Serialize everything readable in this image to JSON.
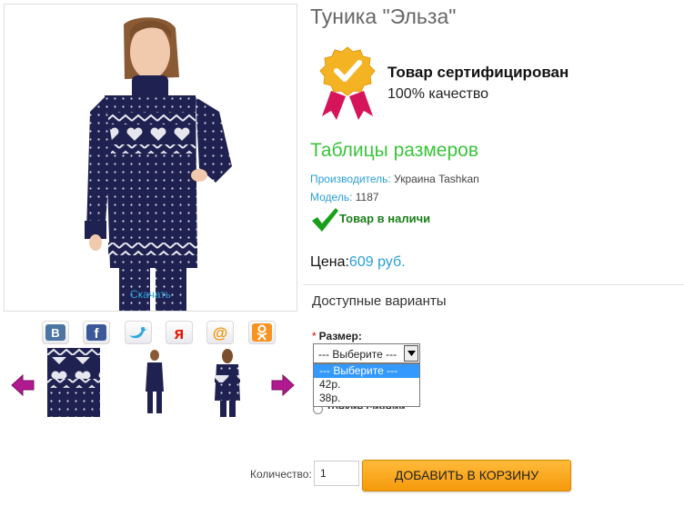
{
  "product": {
    "title": "Туника \"Эльза\"",
    "download_label": "Скачать"
  },
  "certificate": {
    "title": "Товар сертифицирован",
    "subtitle": "100% качество"
  },
  "size_table_link": "Таблицы размеров",
  "manufacturer": {
    "label": "Производитель:",
    "value": "Украина Tashkan"
  },
  "model": {
    "label": "Модель:",
    "value": "1187"
  },
  "stock_status": "Товар в наличи",
  "price": {
    "label": "Цена:",
    "value": "609 руб."
  },
  "variants": {
    "heading": "Доступные варианты",
    "size_label": "Размер:",
    "required_mark": "*",
    "selected": "--- Выберите ---",
    "options": [
      "--- Выберите ---",
      "42р.",
      "38р."
    ],
    "partially_hidden_text": "Тонкие сиянии"
  },
  "quantity": {
    "label": "Количество:",
    "value": "1"
  },
  "add_to_cart_label": "ДОБАВИТЬ В КОРЗИНУ",
  "share_icons": [
    "vk-icon",
    "facebook-icon",
    "twitter-icon",
    "yandex-icon",
    "mail-ru-icon",
    "odnoklassniki-icon"
  ],
  "colors": {
    "link_blue": "#2a9fd6",
    "size_table_green": "#3cc33c",
    "stock_green": "#1a7f1a",
    "cart_orange": "#f59a0b",
    "arrow_magenta": "#b0198f",
    "sweater_navy": "#1f2150"
  }
}
